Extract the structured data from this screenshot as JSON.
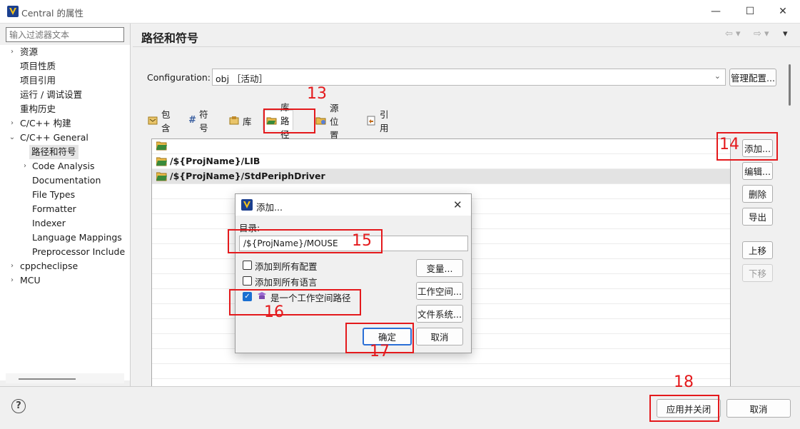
{
  "window": {
    "title": "Central 的属性",
    "minimize": "—",
    "maximize": "☐",
    "close": "✕"
  },
  "sidebar": {
    "filter_placeholder": "输入过滤器文本",
    "items": [
      {
        "label": "资源",
        "twisty": "›"
      },
      {
        "label": "项目性质",
        "twisty": ""
      },
      {
        "label": "项目引用",
        "twisty": ""
      },
      {
        "label": "运行 / 调试设置",
        "twisty": ""
      },
      {
        "label": "重构历史",
        "twisty": ""
      },
      {
        "label": "C/C++ 构建",
        "twisty": "›"
      },
      {
        "label": "C/C++ General",
        "twisty": "⌄"
      },
      {
        "label": "路径和符号",
        "twisty": ""
      },
      {
        "label": "Code Analysis",
        "twisty": "›"
      },
      {
        "label": "Documentation",
        "twisty": ""
      },
      {
        "label": "File Types",
        "twisty": ""
      },
      {
        "label": "Formatter",
        "twisty": ""
      },
      {
        "label": "Indexer",
        "twisty": ""
      },
      {
        "label": "Language Mappings",
        "twisty": ""
      },
      {
        "label": "Preprocessor Include",
        "twisty": ""
      },
      {
        "label": "cppcheclipse",
        "twisty": "›"
      },
      {
        "label": "MCU",
        "twisty": "›"
      }
    ]
  },
  "main": {
    "title": "路径和符号",
    "configuration": {
      "label": "Configuration:",
      "value": "obj ［活动］",
      "manage_button": "管理配置..."
    },
    "tabs": [
      {
        "label": "包含",
        "icon": "include-icon"
      },
      {
        "label": "符号",
        "icon": "hash-icon"
      },
      {
        "label": "库",
        "icon": "library-icon"
      },
      {
        "label": "库路径",
        "icon": "folder-icon"
      },
      {
        "label": "源位置",
        "icon": "source-folder-icon"
      },
      {
        "label": "引用",
        "icon": "reference-icon"
      }
    ],
    "paths": [
      "",
      "/${ProjName}/LIB",
      "/${ProjName}/StdPeriphDriver"
    ],
    "side_buttons": {
      "add": "添加...",
      "edit": "编辑...",
      "delete": "删除",
      "export": "导出",
      "up": "上移",
      "down": "下移"
    }
  },
  "footer": {
    "help": "?",
    "apply_close": "应用并关闭",
    "cancel": "取消"
  },
  "dialog": {
    "title": "添加...",
    "dir_label": "目录:",
    "dir_value": "/${ProjName}/MOUSE",
    "checkboxes": [
      {
        "label": "添加到所有配置",
        "checked": false
      },
      {
        "label": "添加到所有语言",
        "checked": false
      },
      {
        "label": "是一个工作空间路径",
        "checked": true
      }
    ],
    "buttons": {
      "variables": "变量...",
      "workspace": "工作空间...",
      "filesystem": "文件系统...",
      "ok": "确定",
      "cancel": "取消"
    }
  },
  "annotations": {
    "a13": "13",
    "a14": "14",
    "a15": "15",
    "a16": "16",
    "a17": "17",
    "a18": "18",
    "color": "#e4191c"
  }
}
